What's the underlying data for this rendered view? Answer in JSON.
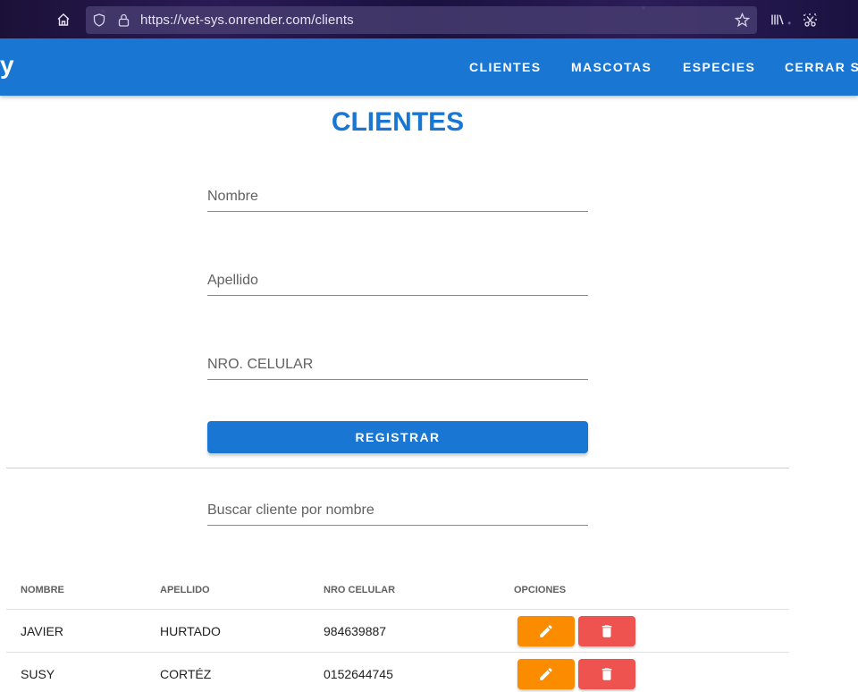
{
  "browser": {
    "url": "https://vet-sys.onrender.com/clients",
    "icons": [
      "home-icon",
      "shield-icon",
      "lock-icon",
      "star-icon",
      "library-icon",
      "screenshot-icon"
    ]
  },
  "appbar": {
    "brand": "y",
    "nav": [
      "CLIENTES",
      "MASCOTAS",
      "ESPECIES",
      "CERRAR SE"
    ]
  },
  "page": {
    "title": "CLIENTES"
  },
  "form": {
    "nombre_placeholder": "Nombre",
    "apellido_placeholder": "Apellido",
    "celular_placeholder": "NRO. CELULAR",
    "register_label": "REGISTRAR"
  },
  "search": {
    "placeholder": "Buscar cliente por nombre"
  },
  "table": {
    "headers": [
      "NOMBRE",
      "APELLIDO",
      "NRO CELULAR",
      "OPCIONES"
    ],
    "rows": [
      {
        "nombre": "JAVIER",
        "apellido": "HURTADO",
        "celular": "984639887"
      },
      {
        "nombre": "SUSY",
        "apellido": "CORTÉZ",
        "celular": "0152644745"
      }
    ]
  },
  "colors": {
    "primary": "#1976d2",
    "edit": "#fb8c00",
    "delete": "#ef5350"
  }
}
